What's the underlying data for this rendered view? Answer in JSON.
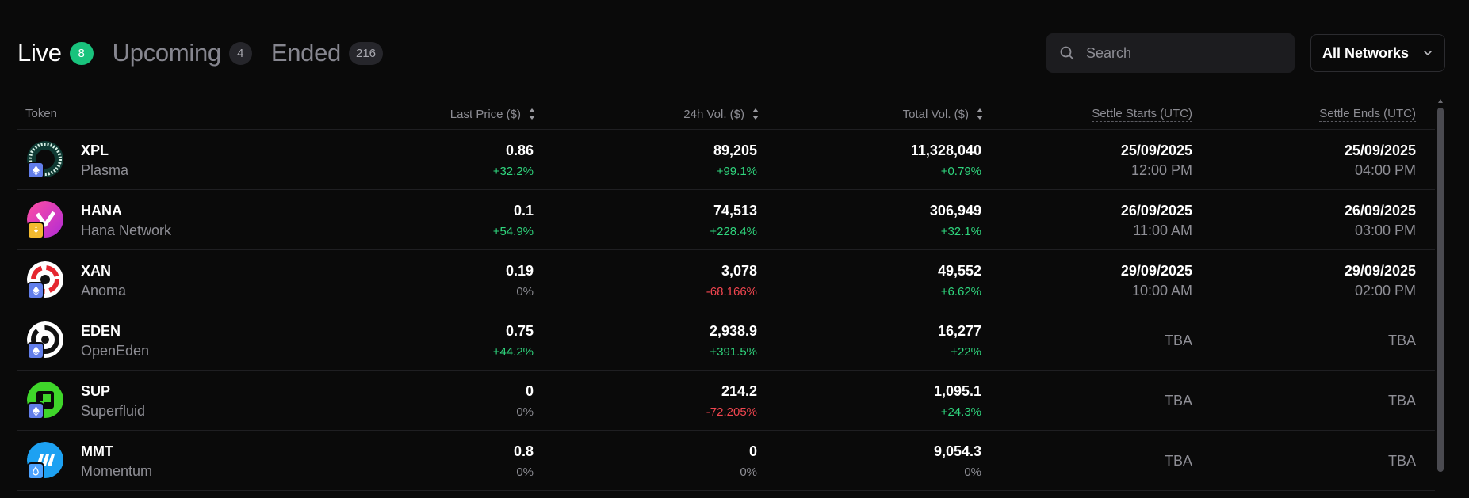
{
  "tabs": [
    {
      "label": "Live",
      "count": "8",
      "active": true
    },
    {
      "label": "Upcoming",
      "count": "4",
      "active": false
    },
    {
      "label": "Ended",
      "count": "216",
      "active": false
    }
  ],
  "search": {
    "placeholder": "Search",
    "icon": "search-icon"
  },
  "network_filter": {
    "label": "All Networks",
    "icon": "chevron-down-icon"
  },
  "columns": {
    "token": "Token",
    "last_price": "Last Price ($)",
    "vol_24h": "24h Vol. ($)",
    "total_vol": "Total Vol. ($)",
    "settle_starts": "Settle Starts (UTC)",
    "settle_ends": "Settle Ends (UTC)"
  },
  "rows": [
    {
      "symbol": "XPL",
      "name": "Plasma",
      "chain": "ethereum",
      "price": "0.86",
      "price_change": "+32.2%",
      "price_dir": "pos",
      "vol24": "89,205",
      "vol24_change": "+99.1%",
      "vol24_dir": "pos",
      "total": "11,328,040",
      "total_change": "+0.79%",
      "total_dir": "pos",
      "start_date": "25/09/2025",
      "start_time": "12:00 PM",
      "end_date": "25/09/2025",
      "end_time": "04:00 PM"
    },
    {
      "symbol": "HANA",
      "name": "Hana Network",
      "chain": "bnb",
      "price": "0.1",
      "price_change": "+54.9%",
      "price_dir": "pos",
      "vol24": "74,513",
      "vol24_change": "+228.4%",
      "vol24_dir": "pos",
      "total": "306,949",
      "total_change": "+32.1%",
      "total_dir": "pos",
      "start_date": "26/09/2025",
      "start_time": "11:00 AM",
      "end_date": "26/09/2025",
      "end_time": "03:00 PM"
    },
    {
      "symbol": "XAN",
      "name": "Anoma",
      "chain": "ethereum",
      "price": "0.19",
      "price_change": "0%",
      "price_dir": "neutral",
      "vol24": "3,078",
      "vol24_change": "-68.166%",
      "vol24_dir": "neg",
      "total": "49,552",
      "total_change": "+6.62%",
      "total_dir": "pos",
      "start_date": "29/09/2025",
      "start_time": "10:00 AM",
      "end_date": "29/09/2025",
      "end_time": "02:00 PM"
    },
    {
      "symbol": "EDEN",
      "name": "OpenEden",
      "chain": "ethereum",
      "price": "0.75",
      "price_change": "+44.2%",
      "price_dir": "pos",
      "vol24": "2,938.9",
      "vol24_change": "+391.5%",
      "vol24_dir": "pos",
      "total": "16,277",
      "total_change": "+22%",
      "total_dir": "pos",
      "start": "TBA",
      "end": "TBA"
    },
    {
      "symbol": "SUP",
      "name": "Superfluid",
      "chain": "ethereum",
      "price": "0",
      "price_change": "0%",
      "price_dir": "neutral",
      "vol24": "214.2",
      "vol24_change": "-72.205%",
      "vol24_dir": "neg",
      "total": "1,095.1",
      "total_change": "+24.3%",
      "total_dir": "pos",
      "start": "TBA",
      "end": "TBA"
    },
    {
      "symbol": "MMT",
      "name": "Momentum",
      "chain": "sui",
      "price": "0.8",
      "price_change": "0%",
      "price_dir": "neutral",
      "vol24": "0",
      "vol24_change": "0%",
      "vol24_dir": "neutral",
      "total": "9,054.3",
      "total_change": "0%",
      "total_dir": "neutral",
      "start": "TBA",
      "end": "TBA"
    }
  ],
  "colors": {
    "accent": "#19c37d",
    "positive": "#2fd57d",
    "negative": "#f0454f",
    "muted": "#8e8e95",
    "background": "#0a0a0a"
  }
}
